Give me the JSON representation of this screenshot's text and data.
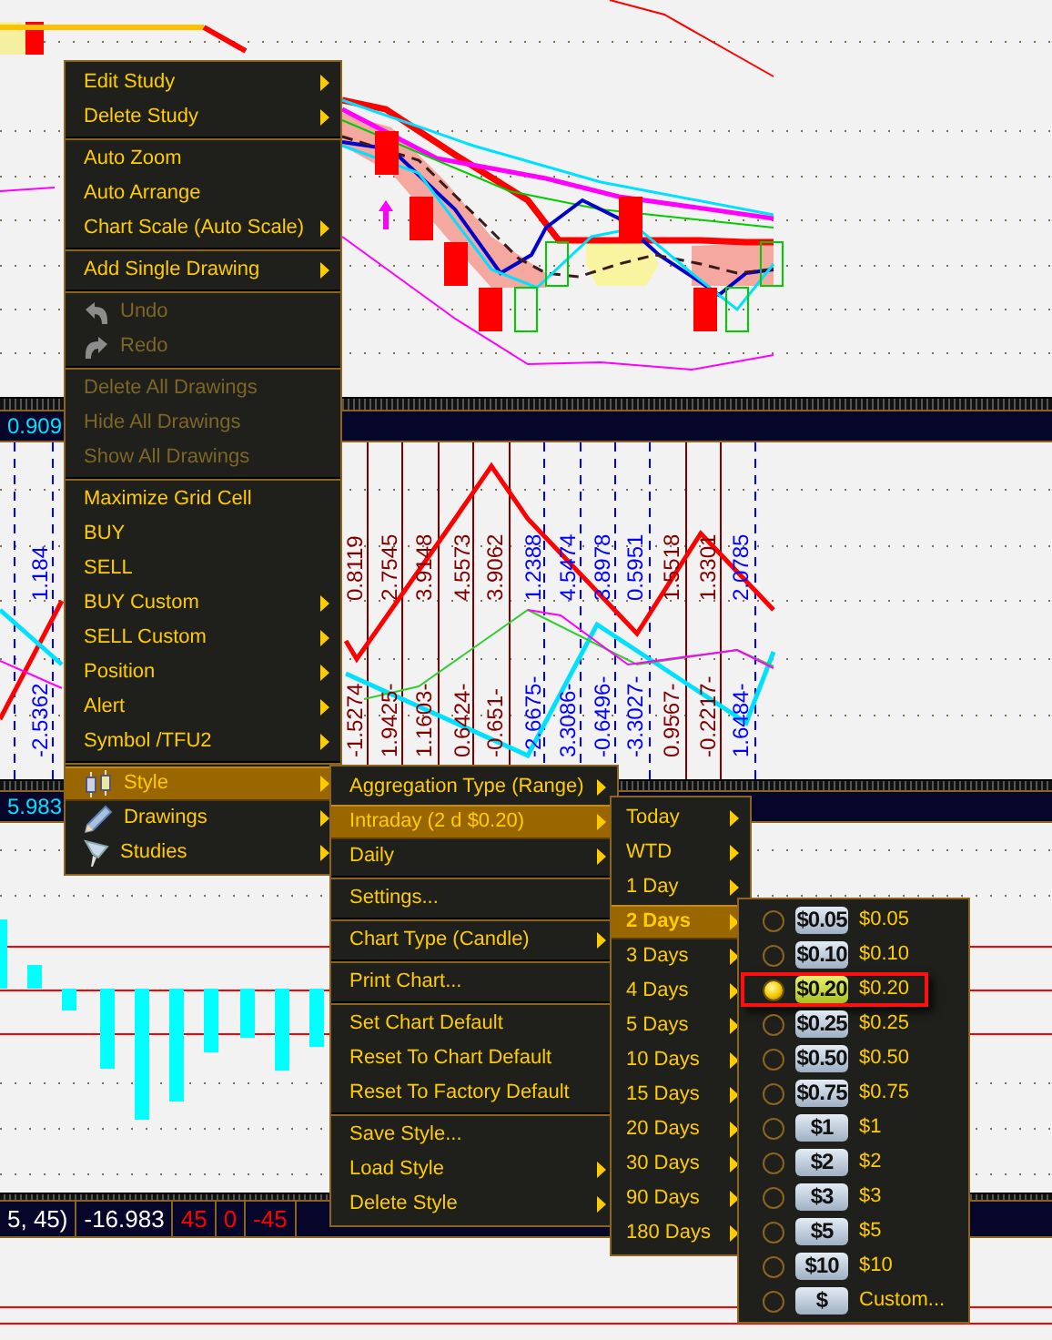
{
  "study_header_1": {
    "value": "0.909"
  },
  "oscillator_labels": {
    "upper": [
      {
        "text": "1.184",
        "color": "#0000ff"
      },
      {
        "text": "0.8119",
        "color": "#800000"
      },
      {
        "text": "2.7545",
        "color": "#800000"
      },
      {
        "text": "3.9148",
        "color": "#800000"
      },
      {
        "text": "4.5573",
        "color": "#800000"
      },
      {
        "text": "3.9062",
        "color": "#800000"
      },
      {
        "text": "1.2388",
        "color": "#0000ff"
      },
      {
        "text": "4.5474",
        "color": "#0000ff"
      },
      {
        "text": "3.8978",
        "color": "#0000ff"
      },
      {
        "text": "0.5951",
        "color": "#0000ff"
      },
      {
        "text": "1.5518",
        "color": "#800000"
      },
      {
        "text": "1.3301",
        "color": "#800000"
      },
      {
        "text": "2.0785",
        "color": "#0000ff"
      }
    ],
    "lower": [
      {
        "text": "-2.5362",
        "color": "#0000ff"
      },
      {
        "text": "-1.5274",
        "color": "#800000"
      },
      {
        "text": "1.9425-",
        "color": "#800000"
      },
      {
        "text": "1.1603-",
        "color": "#800000"
      },
      {
        "text": "0.6424-",
        "color": "#800000"
      },
      {
        "text": "-0.651-",
        "color": "#800000"
      },
      {
        "text": "-2.6675-",
        "color": "#0000ff"
      },
      {
        "text": "3.3086-",
        "color": "#0000ff"
      },
      {
        "text": "-0.6496-",
        "color": "#0000ff"
      },
      {
        "text": "-3.3027-",
        "color": "#0000ff"
      },
      {
        "text": "0.9567-",
        "color": "#800000"
      },
      {
        "text": "-0.2217-",
        "color": "#800000"
      },
      {
        "text": "1.6484-",
        "color": "#0000ff"
      }
    ]
  },
  "study_header_2": {
    "value": "5.983"
  },
  "study_footer": {
    "values": [
      {
        "text": "5, 45)",
        "color": "#ffffff"
      },
      {
        "text": "-16.983",
        "color": "#ffffff"
      },
      {
        "text": "45",
        "color": "#ff0000"
      },
      {
        "text": "0",
        "color": "#ff0000"
      },
      {
        "text": "-45",
        "color": "#ff0000"
      }
    ]
  },
  "context_menu": {
    "groups": [
      [
        {
          "label": "Edit Study",
          "submenu": true,
          "disabled": false,
          "selected": false
        },
        {
          "label": "Delete Study",
          "submenu": true,
          "disabled": false,
          "selected": false
        }
      ],
      [
        {
          "label": "Auto Zoom",
          "submenu": false,
          "disabled": false,
          "selected": false
        },
        {
          "label": "Auto Arrange",
          "submenu": false,
          "disabled": false,
          "selected": false
        },
        {
          "label": "Chart Scale (Auto Scale)",
          "submenu": true,
          "disabled": false,
          "selected": false
        }
      ],
      [
        {
          "label": "Add Single Drawing",
          "submenu": true,
          "disabled": false,
          "selected": false
        }
      ],
      [
        {
          "label": "Undo",
          "submenu": false,
          "disabled": true,
          "selected": false
        },
        {
          "label": "Redo",
          "submenu": false,
          "disabled": true,
          "selected": false
        }
      ],
      [
        {
          "label": "Delete All Drawings",
          "submenu": false,
          "disabled": true,
          "selected": false
        },
        {
          "label": "Hide All Drawings",
          "submenu": false,
          "disabled": true,
          "selected": false
        },
        {
          "label": "Show All Drawings",
          "submenu": false,
          "disabled": true,
          "selected": false
        }
      ],
      [
        {
          "label": "Maximize Grid Cell",
          "submenu": false,
          "disabled": false,
          "selected": false
        },
        {
          "label": "BUY",
          "submenu": false,
          "disabled": false,
          "selected": false
        },
        {
          "label": "SELL",
          "submenu": false,
          "disabled": false,
          "selected": false
        },
        {
          "label": "BUY Custom",
          "submenu": true,
          "disabled": false,
          "selected": false
        },
        {
          "label": "SELL Custom",
          "submenu": true,
          "disabled": false,
          "selected": false
        },
        {
          "label": "Position",
          "submenu": true,
          "disabled": false,
          "selected": false
        },
        {
          "label": "Alert",
          "submenu": true,
          "disabled": false,
          "selected": false
        },
        {
          "label": "Symbol /TFU2",
          "submenu": true,
          "disabled": false,
          "selected": false
        }
      ],
      [
        {
          "label": "Style",
          "submenu": true,
          "disabled": false,
          "selected": true
        },
        {
          "label": "Drawings",
          "submenu": true,
          "disabled": false,
          "selected": false
        },
        {
          "label": "Studies",
          "submenu": true,
          "disabled": false,
          "selected": false
        }
      ]
    ]
  },
  "style_menu": {
    "groups": [
      [
        {
          "label": "Aggregation Type (Range)",
          "submenu": true,
          "selected": false
        },
        {
          "label": "Intraday (2 d $0.20)",
          "submenu": true,
          "selected": true
        },
        {
          "label": "Daily",
          "submenu": true,
          "selected": false
        }
      ],
      [
        {
          "label": "Settings...",
          "submenu": false,
          "selected": false
        }
      ],
      [
        {
          "label": "Chart Type (Candle)",
          "submenu": true,
          "selected": false
        }
      ],
      [
        {
          "label": "Print Chart...",
          "submenu": false,
          "selected": false
        }
      ],
      [
        {
          "label": "Set Chart Default",
          "submenu": false,
          "selected": false
        },
        {
          "label": "Reset To Chart Default",
          "submenu": false,
          "selected": false
        },
        {
          "label": "Reset To Factory Default",
          "submenu": false,
          "selected": false
        }
      ],
      [
        {
          "label": "Save Style...",
          "submenu": false,
          "selected": false
        },
        {
          "label": "Load Style",
          "submenu": true,
          "selected": false
        },
        {
          "label": "Delete Style",
          "submenu": true,
          "selected": false
        }
      ]
    ]
  },
  "period_menu": {
    "items": [
      {
        "label": "Today",
        "selected": false,
        "current": false
      },
      {
        "label": "WTD",
        "selected": false,
        "current": false
      },
      {
        "label": "1 Day",
        "selected": false,
        "current": false
      },
      {
        "label": "2 Days",
        "selected": true,
        "current": true
      },
      {
        "label": "3 Days",
        "selected": false,
        "current": false
      },
      {
        "label": "4 Days",
        "selected": false,
        "current": false
      },
      {
        "label": "5 Days",
        "selected": false,
        "current": false
      },
      {
        "label": "10 Days",
        "selected": false,
        "current": false
      },
      {
        "label": "15 Days",
        "selected": false,
        "current": false
      },
      {
        "label": "20 Days",
        "selected": false,
        "current": false
      },
      {
        "label": "30 Days",
        "selected": false,
        "current": false
      },
      {
        "label": "90 Days",
        "selected": false,
        "current": false
      },
      {
        "label": "180 Days",
        "selected": false,
        "current": false
      }
    ]
  },
  "range_menu": {
    "items": [
      {
        "tag": "$0.05",
        "label": "$0.05",
        "selected": false
      },
      {
        "tag": "$0.10",
        "label": "$0.10",
        "selected": false
      },
      {
        "tag": "$0.20",
        "label": "$0.20",
        "selected": true
      },
      {
        "tag": "$0.25",
        "label": "$0.25",
        "selected": false
      },
      {
        "tag": "$0.50",
        "label": "$0.50",
        "selected": false
      },
      {
        "tag": "$0.75",
        "label": "$0.75",
        "selected": false
      },
      {
        "tag": "$1",
        "label": "$1",
        "selected": false
      },
      {
        "tag": "$2",
        "label": "$2",
        "selected": false
      },
      {
        "tag": "$3",
        "label": "$3",
        "selected": false
      },
      {
        "tag": "$5",
        "label": "$5",
        "selected": false
      },
      {
        "tag": "$10",
        "label": "$10",
        "selected": false
      },
      {
        "tag": "$",
        "label": "Custom...",
        "selected": false
      }
    ]
  }
}
